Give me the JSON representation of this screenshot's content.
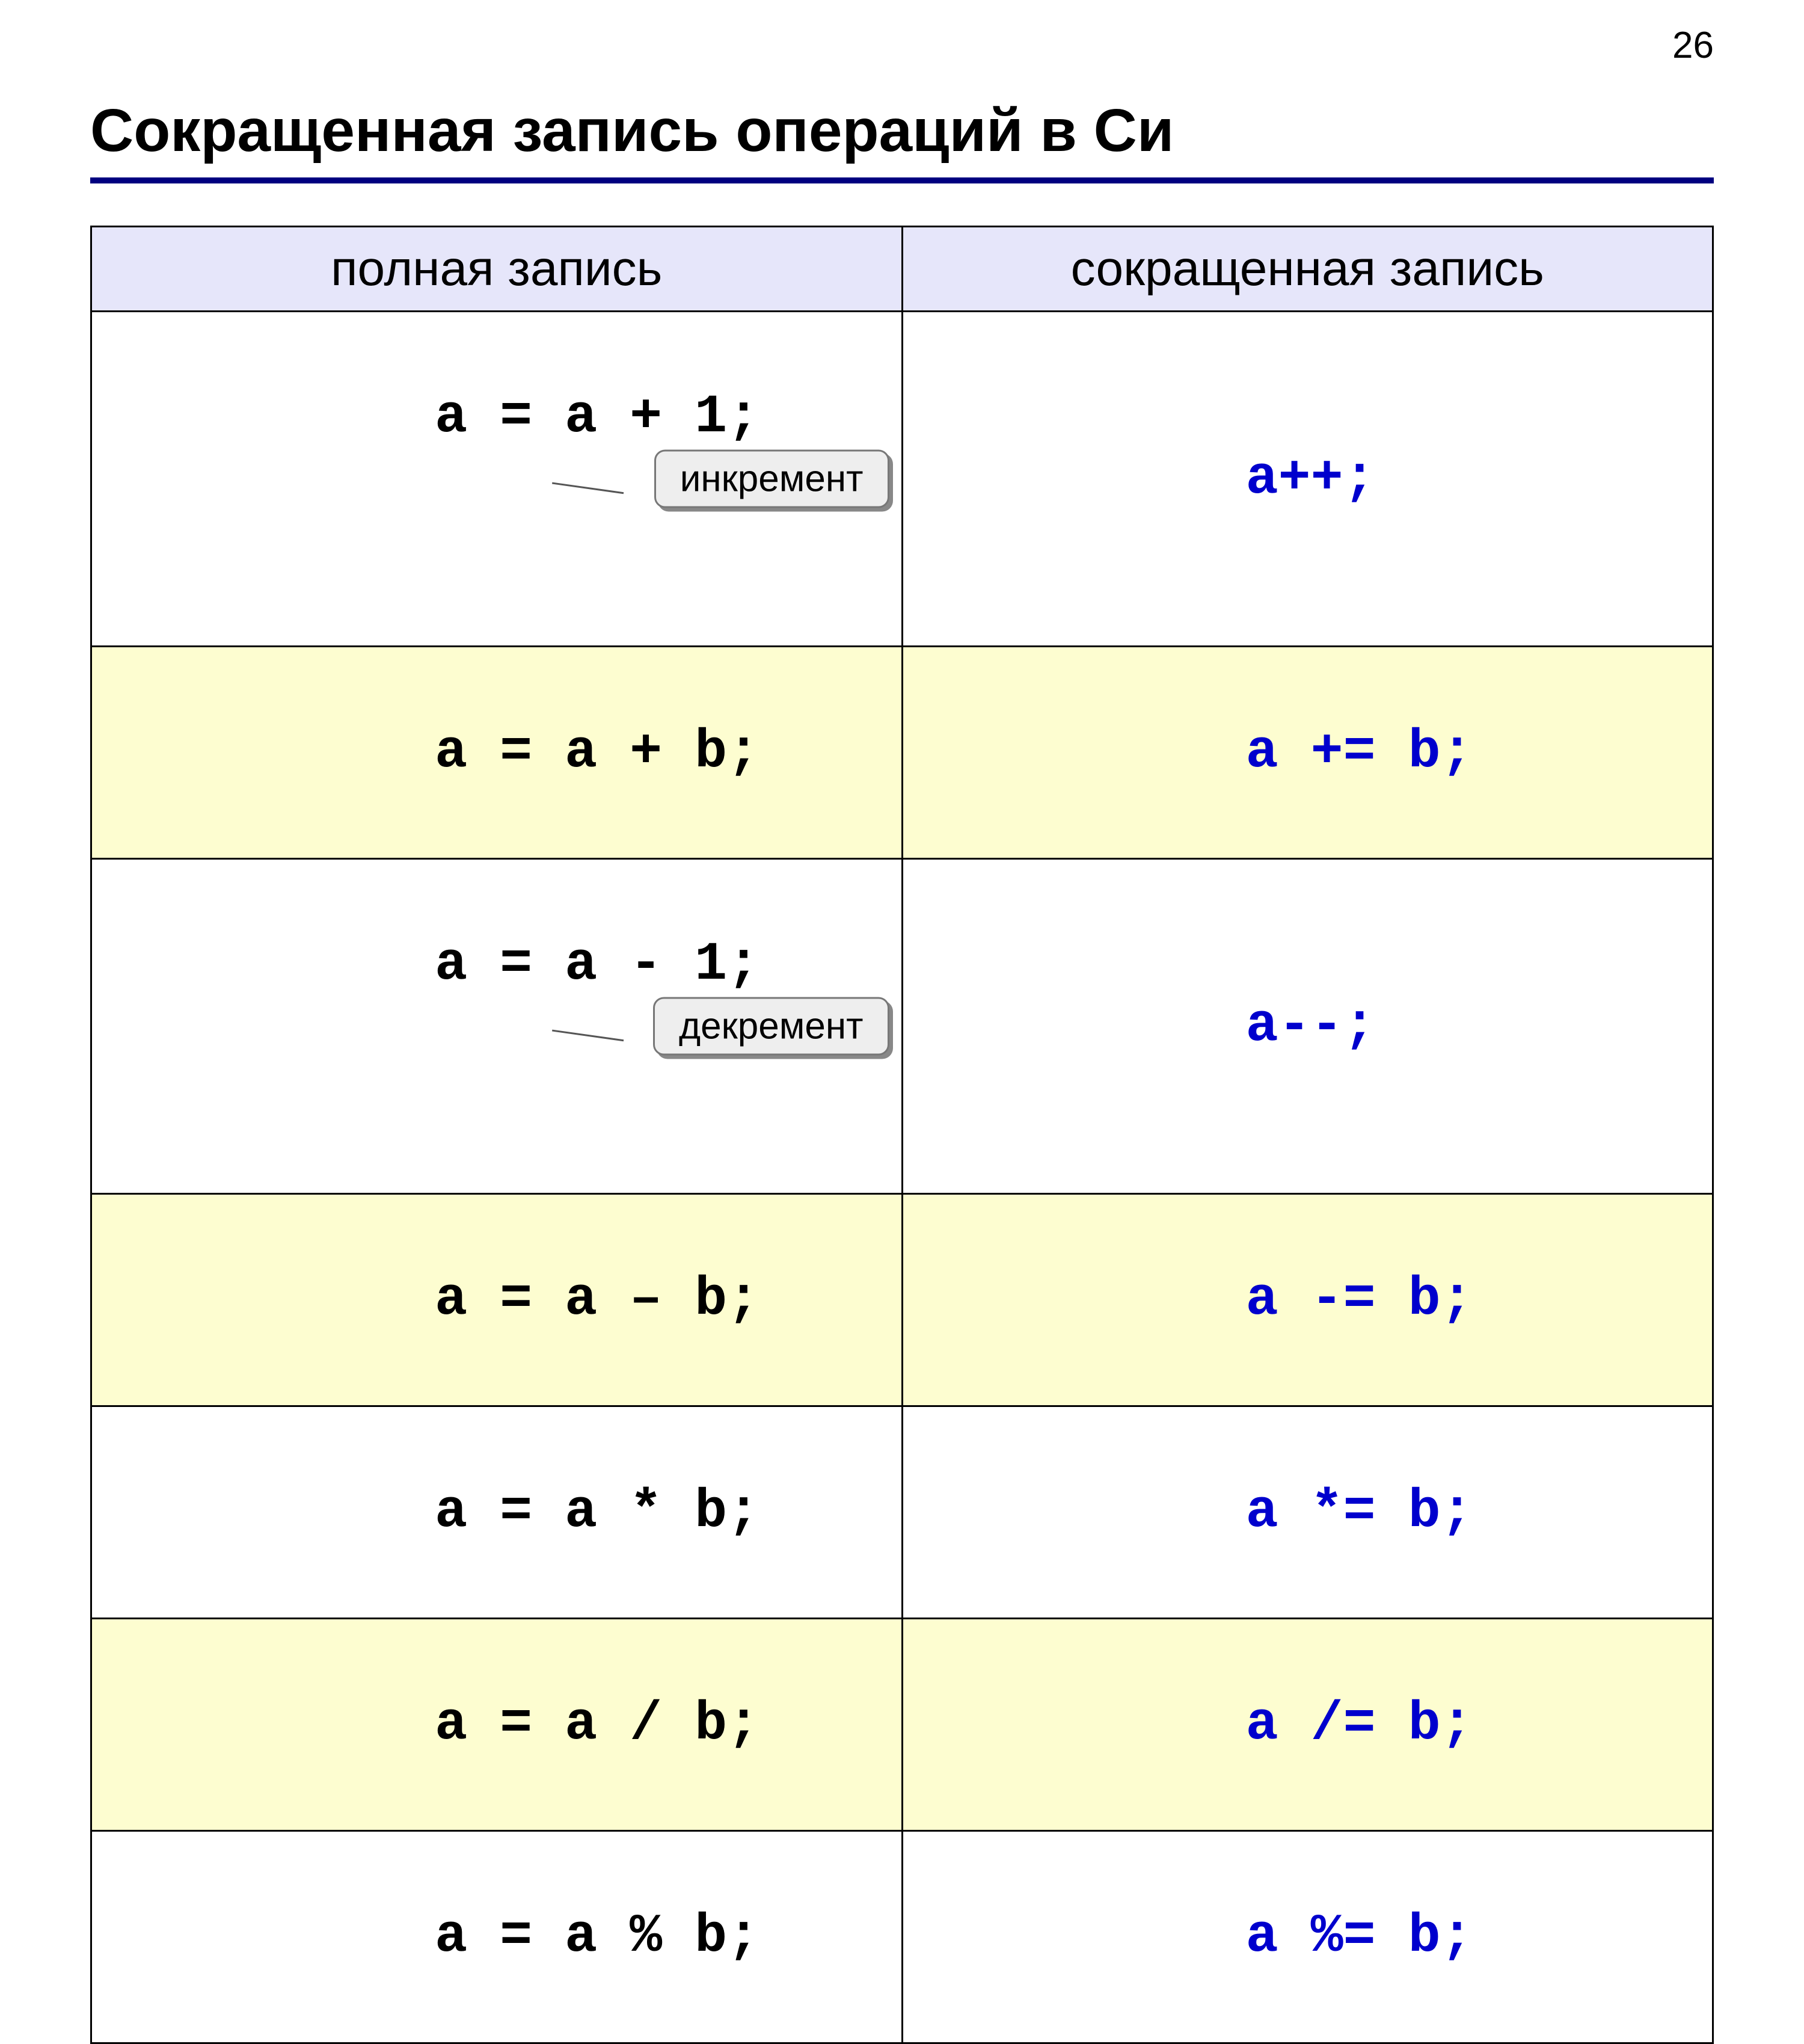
{
  "page_number": "26",
  "title": "Сокращенная запись операций в Си",
  "headers": {
    "full": "полная запись",
    "short": "сокращенная запись"
  },
  "callouts": {
    "increment": "инкремент",
    "decrement": "декремент"
  },
  "rows": [
    {
      "full": "a = a + 1;",
      "short": "a++;",
      "alt": false,
      "callout": "increment"
    },
    {
      "full": "a = a + b;",
      "short": "a += b;",
      "alt": true
    },
    {
      "full": "a = a - 1;",
      "short": "a--;",
      "alt": false,
      "callout": "decrement"
    },
    {
      "full": "a = a – b;",
      "short": "a -= b;",
      "alt": true
    },
    {
      "full": "a = a * b;",
      "short": "a *= b;",
      "alt": false
    },
    {
      "full": "a = a / b;",
      "short": "a /= b;",
      "alt": true
    },
    {
      "full": "a = a % b;",
      "short": "a %= b;",
      "alt": false
    }
  ]
}
